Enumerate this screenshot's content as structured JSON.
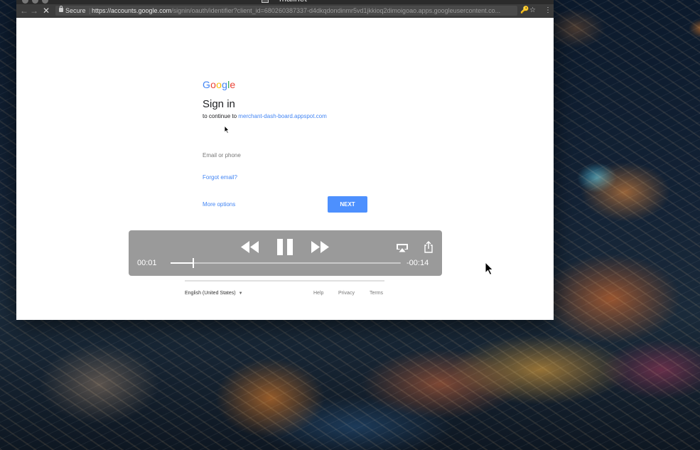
{
  "window": {
    "title": "mailnet"
  },
  "toolbar": {
    "back_icon": "back-arrow-icon",
    "forward_icon": "forward-arrow-icon",
    "stop_icon": "stop-loading-icon",
    "secure_label": "Secure",
    "url_base": "https://accounts.google.com",
    "url_rest": "/signin/oauth/identifier?client_id=680260387337-d4dkqdondinmr5vd1jkkioq2dimoigoao.apps.googleusercontent.co...",
    "extension_icon": "extension-icon",
    "star_icon": "star-icon",
    "menu_icon": "kebab-menu-icon"
  },
  "signin": {
    "logo": [
      "G",
      "o",
      "o",
      "g",
      "l",
      "e"
    ],
    "logo_colors": [
      "#4285F4",
      "#EA4335",
      "#FBBC05",
      "#4285F4",
      "#34A853",
      "#EA4335"
    ],
    "heading": "Sign in",
    "continue_prefix": "to continue to",
    "continue_link": "merchant-dash-board.appspot.com",
    "email_placeholder": "Email or phone",
    "forgot_email": "Forgot email?",
    "more_options": "More options",
    "next_button": "NEXT"
  },
  "footer": {
    "language": "English (United States)",
    "help": "Help",
    "privacy": "Privacy",
    "terms": "Terms"
  },
  "player": {
    "elapsed": "00:01",
    "remaining": "-00:14",
    "progress": 0.1,
    "controls": [
      "rewind-icon",
      "pause-icon",
      "fast-forward-icon",
      "airplay-icon",
      "share-icon"
    ]
  }
}
